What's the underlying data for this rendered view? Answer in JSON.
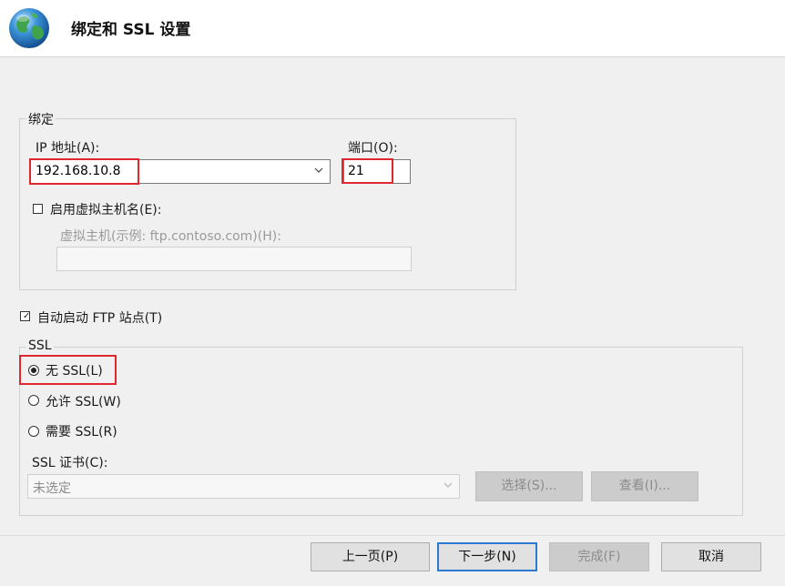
{
  "header": {
    "title": "绑定和 SSL 设置",
    "icon": "globe-icon"
  },
  "binding": {
    "group_label": "绑定",
    "ip_label": "IP 地址(A):",
    "ip_value": "192.168.10.8",
    "port_label": "端口(O):",
    "port_value": "21",
    "vhost_checkbox_label": "启用虚拟主机名(E):",
    "vhost_checked": false,
    "vhost_label": "虚拟主机(示例: ftp.contoso.com)(H):",
    "vhost_value": ""
  },
  "autostart": {
    "label": "自动启动 FTP 站点(T)",
    "checked": true
  },
  "ssl": {
    "group_label": "SSL",
    "options": [
      {
        "label": "无 SSL(L)",
        "selected": true
      },
      {
        "label": "允许 SSL(W)",
        "selected": false
      },
      {
        "label": "需要 SSL(R)",
        "selected": false
      }
    ],
    "cert_label": "SSL 证书(C):",
    "cert_value": "未选定",
    "select_button": "选择(S)...",
    "view_button": "查看(I)..."
  },
  "footer": {
    "prev_button": "上一页(P)",
    "next_button": "下一步(N)",
    "finish_button": "完成(F)",
    "cancel_button": "取消"
  },
  "colors": {
    "highlight": "#e0262e",
    "default_button_border": "#2b79d0"
  }
}
